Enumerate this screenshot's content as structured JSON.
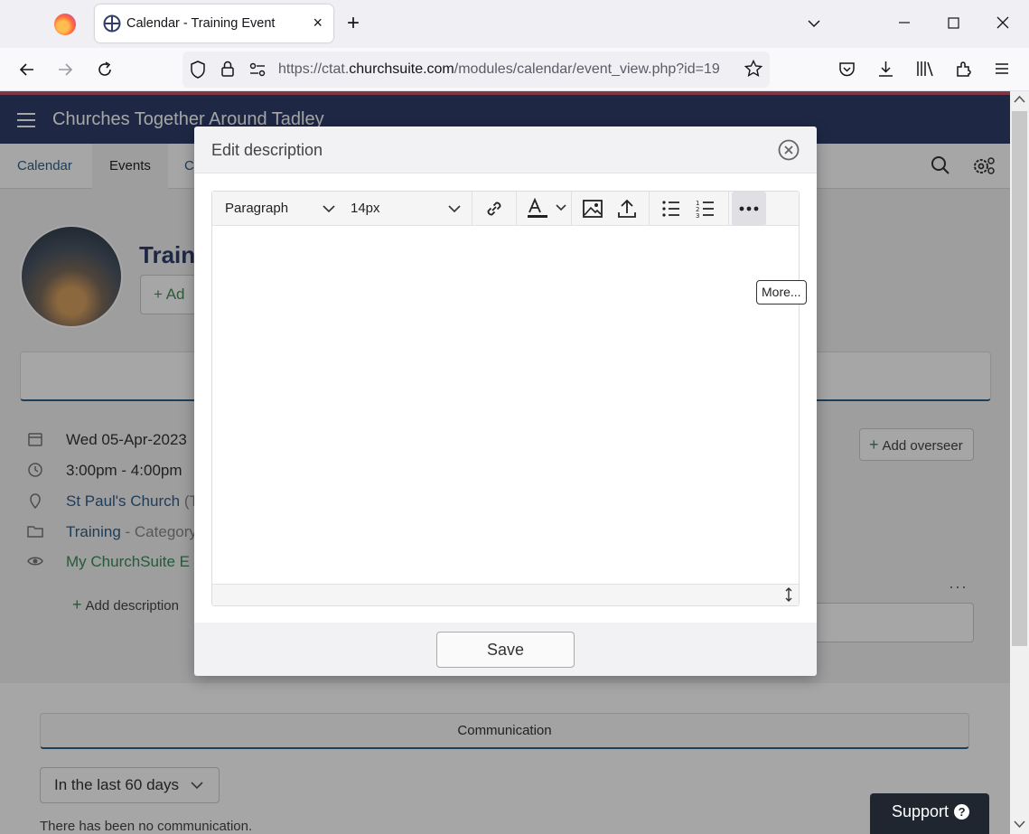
{
  "browser": {
    "tab_title": "Calendar - Training Event",
    "tab_close": "×",
    "new_tab": "+",
    "url_prefix": "https://ctat.",
    "url_domain": "churchsuite.com",
    "url_path": "/modules/calendar/event_view.php?id=19"
  },
  "app": {
    "title": "Churches Together Around Tadley",
    "subnav": [
      {
        "label": "Calendar"
      },
      {
        "label": "Events"
      },
      {
        "label": "C"
      }
    ]
  },
  "event": {
    "title_fragment": "Train",
    "add_fragment": "+ Ad",
    "date": "Wed 05-Apr-2023",
    "time": "3:00pm - 4:00pm",
    "location": "St Paul's Church",
    "location_suffix": " (T",
    "category": "Training",
    "category_suffix": " - Category",
    "visibility": "My ChurchSuite",
    "visibility_suffix": "  E",
    "add_description": "Add description",
    "add_overseer": "Add overseer",
    "more": "···"
  },
  "communication": {
    "tab_label": "Communication",
    "period": "In the last 60 days",
    "empty_text": "There has been no communication."
  },
  "support": {
    "label": "Support",
    "icon": "?"
  },
  "modal": {
    "title": "Edit description",
    "toolbar": {
      "block_format": "Paragraph",
      "font_size": "14px"
    },
    "tooltip": "More...",
    "save_label": "Save"
  },
  "colors": {
    "header": "#2f3e6b",
    "accent_green": "#3a8a5a",
    "link_blue": "#2f5f8a"
  }
}
